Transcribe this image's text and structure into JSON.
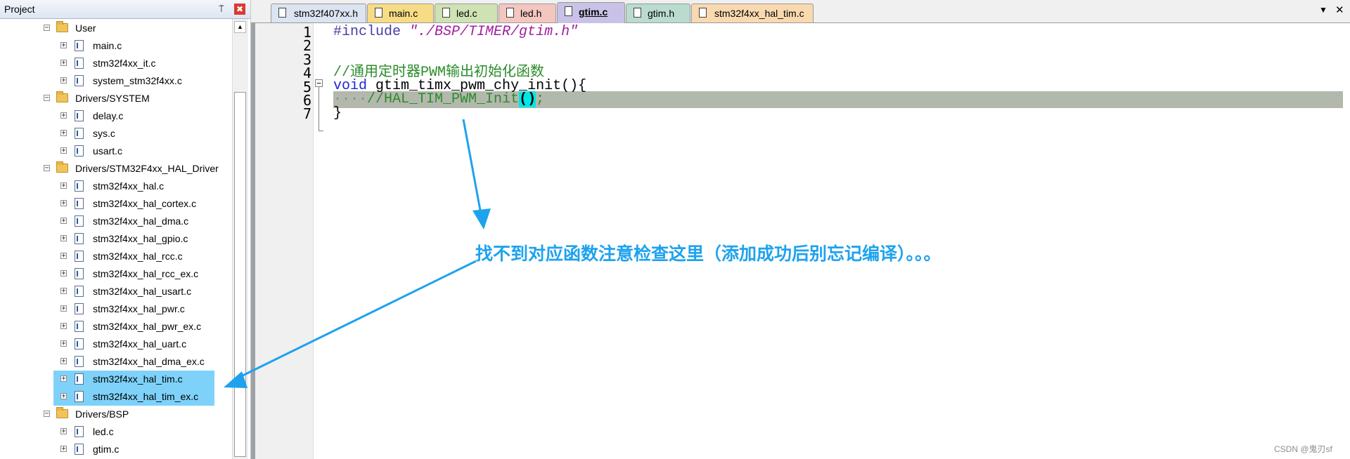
{
  "project_panel": {
    "title": "Project",
    "pin": "⍑",
    "close": "✖",
    "tree": [
      {
        "type": "folder",
        "label": "User",
        "level": 1,
        "expanded": true
      },
      {
        "type": "file",
        "label": "main.c",
        "level": 2
      },
      {
        "type": "file",
        "label": "stm32f4xx_it.c",
        "level": 2
      },
      {
        "type": "file",
        "label": "system_stm32f4xx.c",
        "level": 2
      },
      {
        "type": "folder",
        "label": "Drivers/SYSTEM",
        "level": 1,
        "expanded": true
      },
      {
        "type": "file",
        "label": "delay.c",
        "level": 2
      },
      {
        "type": "file",
        "label": "sys.c",
        "level": 2
      },
      {
        "type": "file",
        "label": "usart.c",
        "level": 2
      },
      {
        "type": "folder",
        "label": "Drivers/STM32F4xx_HAL_Driver",
        "level": 1,
        "expanded": true
      },
      {
        "type": "file",
        "label": "stm32f4xx_hal.c",
        "level": 2
      },
      {
        "type": "file",
        "label": "stm32f4xx_hal_cortex.c",
        "level": 2
      },
      {
        "type": "file",
        "label": "stm32f4xx_hal_dma.c",
        "level": 2
      },
      {
        "type": "file",
        "label": "stm32f4xx_hal_gpio.c",
        "level": 2
      },
      {
        "type": "file",
        "label": "stm32f4xx_hal_rcc.c",
        "level": 2
      },
      {
        "type": "file",
        "label": "stm32f4xx_hal_rcc_ex.c",
        "level": 2
      },
      {
        "type": "file",
        "label": "stm32f4xx_hal_usart.c",
        "level": 2
      },
      {
        "type": "file",
        "label": "stm32f4xx_hal_pwr.c",
        "level": 2
      },
      {
        "type": "file",
        "label": "stm32f4xx_hal_pwr_ex.c",
        "level": 2
      },
      {
        "type": "file",
        "label": "stm32f4xx_hal_uart.c",
        "level": 2
      },
      {
        "type": "file",
        "label": "stm32f4xx_hal_dma_ex.c",
        "level": 2
      },
      {
        "type": "file",
        "label": "stm32f4xx_hal_tim.c",
        "level": 2,
        "selected": true
      },
      {
        "type": "file",
        "label": "stm32f4xx_hal_tim_ex.c",
        "level": 2,
        "selected": true
      },
      {
        "type": "folder",
        "label": "Drivers/BSP",
        "level": 1,
        "expanded": true
      },
      {
        "type": "file",
        "label": "led.c",
        "level": 2
      },
      {
        "type": "file",
        "label": "gtim.c",
        "level": 2
      }
    ]
  },
  "tabs": [
    {
      "label": "stm32f407xx.h",
      "color": "#dbe4f0",
      "active": false
    },
    {
      "label": "main.c",
      "color": "#f7dc86",
      "active": false
    },
    {
      "label": "led.c",
      "color": "#cfe2b3",
      "active": false
    },
    {
      "label": "led.h",
      "color": "#f4c6c0",
      "active": false
    },
    {
      "label": "gtim.c",
      "color": "#c9c2e6",
      "active": true
    },
    {
      "label": "gtim.h",
      "color": "#b9dccf",
      "active": false
    },
    {
      "label": "stm32f4xx_hal_tim.c",
      "color": "#f9d9b0",
      "active": false
    }
  ],
  "tab_controls": {
    "menu": "▼",
    "close": "✕"
  },
  "editor": {
    "line_numbers": [
      "1",
      "2",
      "3",
      "4",
      "5",
      "6",
      "7"
    ],
    "line1": {
      "pre": "#include",
      "str": "\"./BSP/TIMER/gtim.h\""
    },
    "line3": {
      "comment": "//通用定时器PWM输出初始化函数"
    },
    "line4": {
      "kw": "void",
      "rest": "gtim_timx_pwm_chy_init(){"
    },
    "line5": {
      "dots": "····",
      "comment": "//HAL_TIM_PWM_Init",
      "paren": "()",
      "tail": ";"
    },
    "line6": {
      "text": "}"
    },
    "fold_minus": "−"
  },
  "annotation": {
    "text": "找不到对应函数注意检查这里（添加成功后别忘记编译）。。。",
    "color": "#1ea2ee"
  },
  "watermark": "CSDN @鬼刃sf"
}
